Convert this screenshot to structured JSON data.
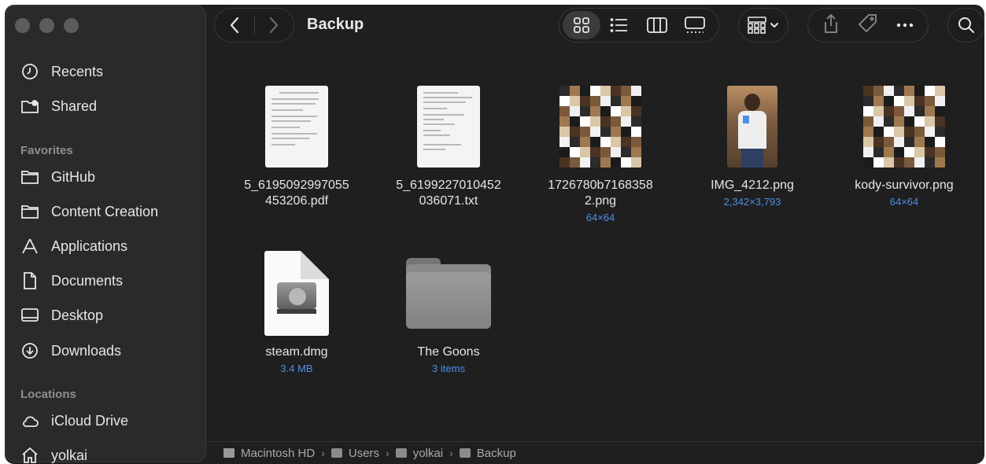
{
  "window": {
    "title": "Backup"
  },
  "sidebar": {
    "top_items": [
      {
        "label": "Recents",
        "icon": "clock-icon"
      },
      {
        "label": "Shared",
        "icon": "shared-folder-icon"
      }
    ],
    "favorites_header": "Favorites",
    "favorites": [
      {
        "label": "GitHub",
        "icon": "folder-icon"
      },
      {
        "label": "Content Creation",
        "icon": "folder-icon"
      },
      {
        "label": "Applications",
        "icon": "applications-icon"
      },
      {
        "label": "Documents",
        "icon": "document-icon"
      },
      {
        "label": "Desktop",
        "icon": "desktop-icon"
      },
      {
        "label": "Downloads",
        "icon": "download-icon"
      }
    ],
    "locations_header": "Locations",
    "locations": [
      {
        "label": "iCloud Drive",
        "icon": "cloud-icon"
      },
      {
        "label": "yolkai",
        "icon": "home-icon"
      }
    ]
  },
  "files": [
    {
      "name_line1": "5_6195092997055",
      "name_line2": "453206.pdf",
      "meta": "",
      "kind": "pdf"
    },
    {
      "name_line1": "5_6199227010452",
      "name_line2": "036071.txt",
      "meta": "",
      "kind": "txt"
    },
    {
      "name_line1": "1726780b7168358",
      "name_line2": "2.png",
      "meta": "64×64",
      "kind": "png"
    },
    {
      "name_line1": "IMG_4212.png",
      "name_line2": "",
      "meta": "2,342×3,793",
      "kind": "photo"
    },
    {
      "name_line1": "kody-survivor.png",
      "name_line2": "",
      "meta": "64×64",
      "kind": "png"
    },
    {
      "name_line1": "steam.dmg",
      "name_line2": "",
      "meta": "3.4 MB",
      "kind": "dmg"
    },
    {
      "name_line1": "The Goons",
      "name_line2": "",
      "meta": "3 items",
      "kind": "folder"
    }
  ],
  "pathbar": [
    "Macintosh HD",
    "Users",
    "yolkai",
    "Backup"
  ],
  "colors": {
    "accent_meta": "#4e8ee8",
    "window_bg": "#1f1f1f",
    "sidebar_bg": "#2a2a2a"
  }
}
